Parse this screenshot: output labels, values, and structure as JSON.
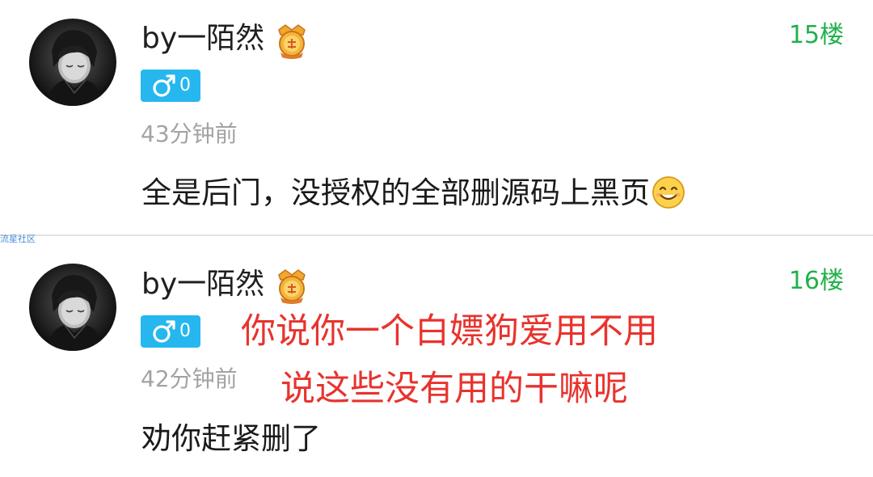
{
  "posts": [
    {
      "username": "by一陌然",
      "floor": "15楼",
      "gender_level": "0",
      "time": "43分钟前",
      "content": "全是后门，没授权的全部删源码上黑页"
    },
    {
      "username": "by一陌然",
      "floor": "16楼",
      "gender_level": "0",
      "time": "42分钟前",
      "content": "劝你赶紧删了"
    }
  ],
  "watermark": "流星社区",
  "annotations": [
    "你说你一个白嫖狗爱用不用",
    "说这些没有用的干嘛呢"
  ],
  "colors": {
    "floor": "#22b14c",
    "gender_badge": "#26b7ee",
    "time": "#a3a3a3",
    "annotation": "#e8332e",
    "divider": "#e3e3e3",
    "watermark": "#4a8fd8"
  },
  "icons": {
    "medal": "medal-icon",
    "gender": "male-symbol-icon",
    "emoji": "smile-emoji-icon"
  }
}
